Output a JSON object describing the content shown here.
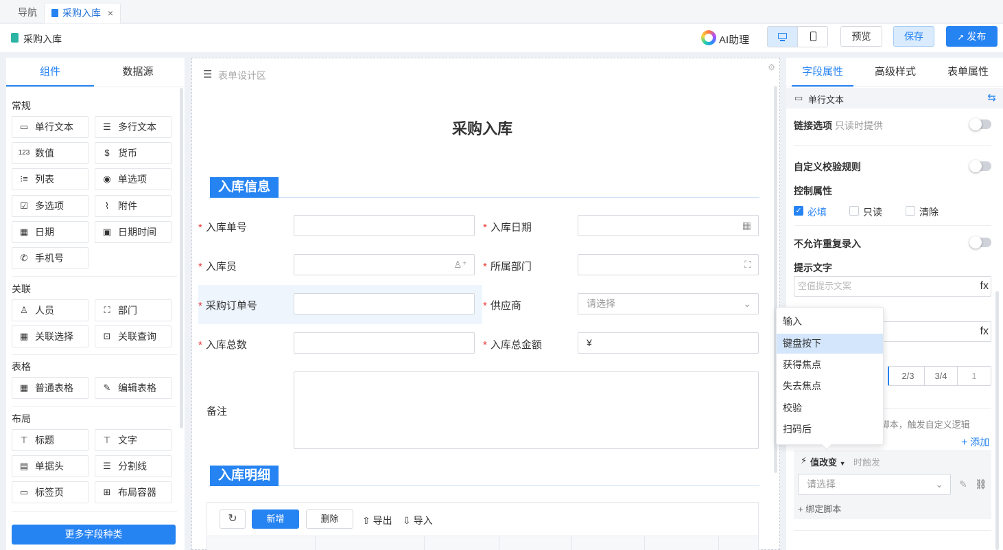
{
  "tabs": {
    "nav": "导航",
    "active": "采购入库",
    "close": "×"
  },
  "header": {
    "title": "采购入库",
    "ai": "AI助理",
    "preview": "预览",
    "save": "保存",
    "publish": "发布"
  },
  "left": {
    "tab_components": "组件",
    "tab_datasource": "数据源",
    "cat_common": "常规",
    "cat_relation": "关联",
    "cat_table": "表格",
    "cat_layout": "布局",
    "items": [
      "单行文本",
      "多行文本",
      "数值",
      "货币",
      "列表",
      "单选项",
      "多选项",
      "附件",
      "日期",
      "日期时间",
      "手机号",
      "人员",
      "部门",
      "关联选择",
      "关联查询",
      "普通表格",
      "编辑表格",
      "标题",
      "文字",
      "单据头",
      "分割线",
      "标签页",
      "布局容器"
    ],
    "more": "更多字段种类"
  },
  "canvas": {
    "area_label": "表单设计区",
    "form_title": "采购入库",
    "section1": "入库信息",
    "section2": "入库明细",
    "required_mark": "*",
    "fields": {
      "receipt_no": "入库单号",
      "receipt_date": "入库日期",
      "operator": "入库员",
      "department": "所属部门",
      "po_no": "采购订单号",
      "supplier": "供应商",
      "total_qty": "入库总数",
      "total_amount": "入库总金额",
      "remark": "备注"
    },
    "supplier_placeholder": "请选择",
    "currency_symbol": "¥",
    "toolbar": {
      "add": "新增",
      "delete": "删除",
      "export": "导出",
      "import": "导入"
    }
  },
  "right": {
    "tab_field": "字段属性",
    "tab_style": "高级样式",
    "tab_form": "表单属性",
    "field_type": "单行文本",
    "link_option": "链接选项",
    "link_option_sub": "只读时提供",
    "custom_rule": "自定义校验规则",
    "control_props": "控制属性",
    "required": "必填",
    "readonly": "只读",
    "clear": "清除",
    "no_duplicate": "不允许重复录入",
    "hint_text": "提示文字",
    "hint_placeholder": "空值提示文案",
    "fx": "fx",
    "width_options": [
      "2/3",
      "3/4",
      "1"
    ],
    "script_desc": "t脚本，触发自定义逻辑",
    "add": "添加",
    "event": "值改变",
    "event_sub": "时触发",
    "select_placeholder": "请选择",
    "bind_script": "绑定脚本"
  },
  "dropdown": {
    "items": [
      "输入",
      "键盘按下",
      "获得焦点",
      "失去焦点",
      "校验",
      "扫码后"
    ],
    "highlighted": "键盘按下"
  }
}
